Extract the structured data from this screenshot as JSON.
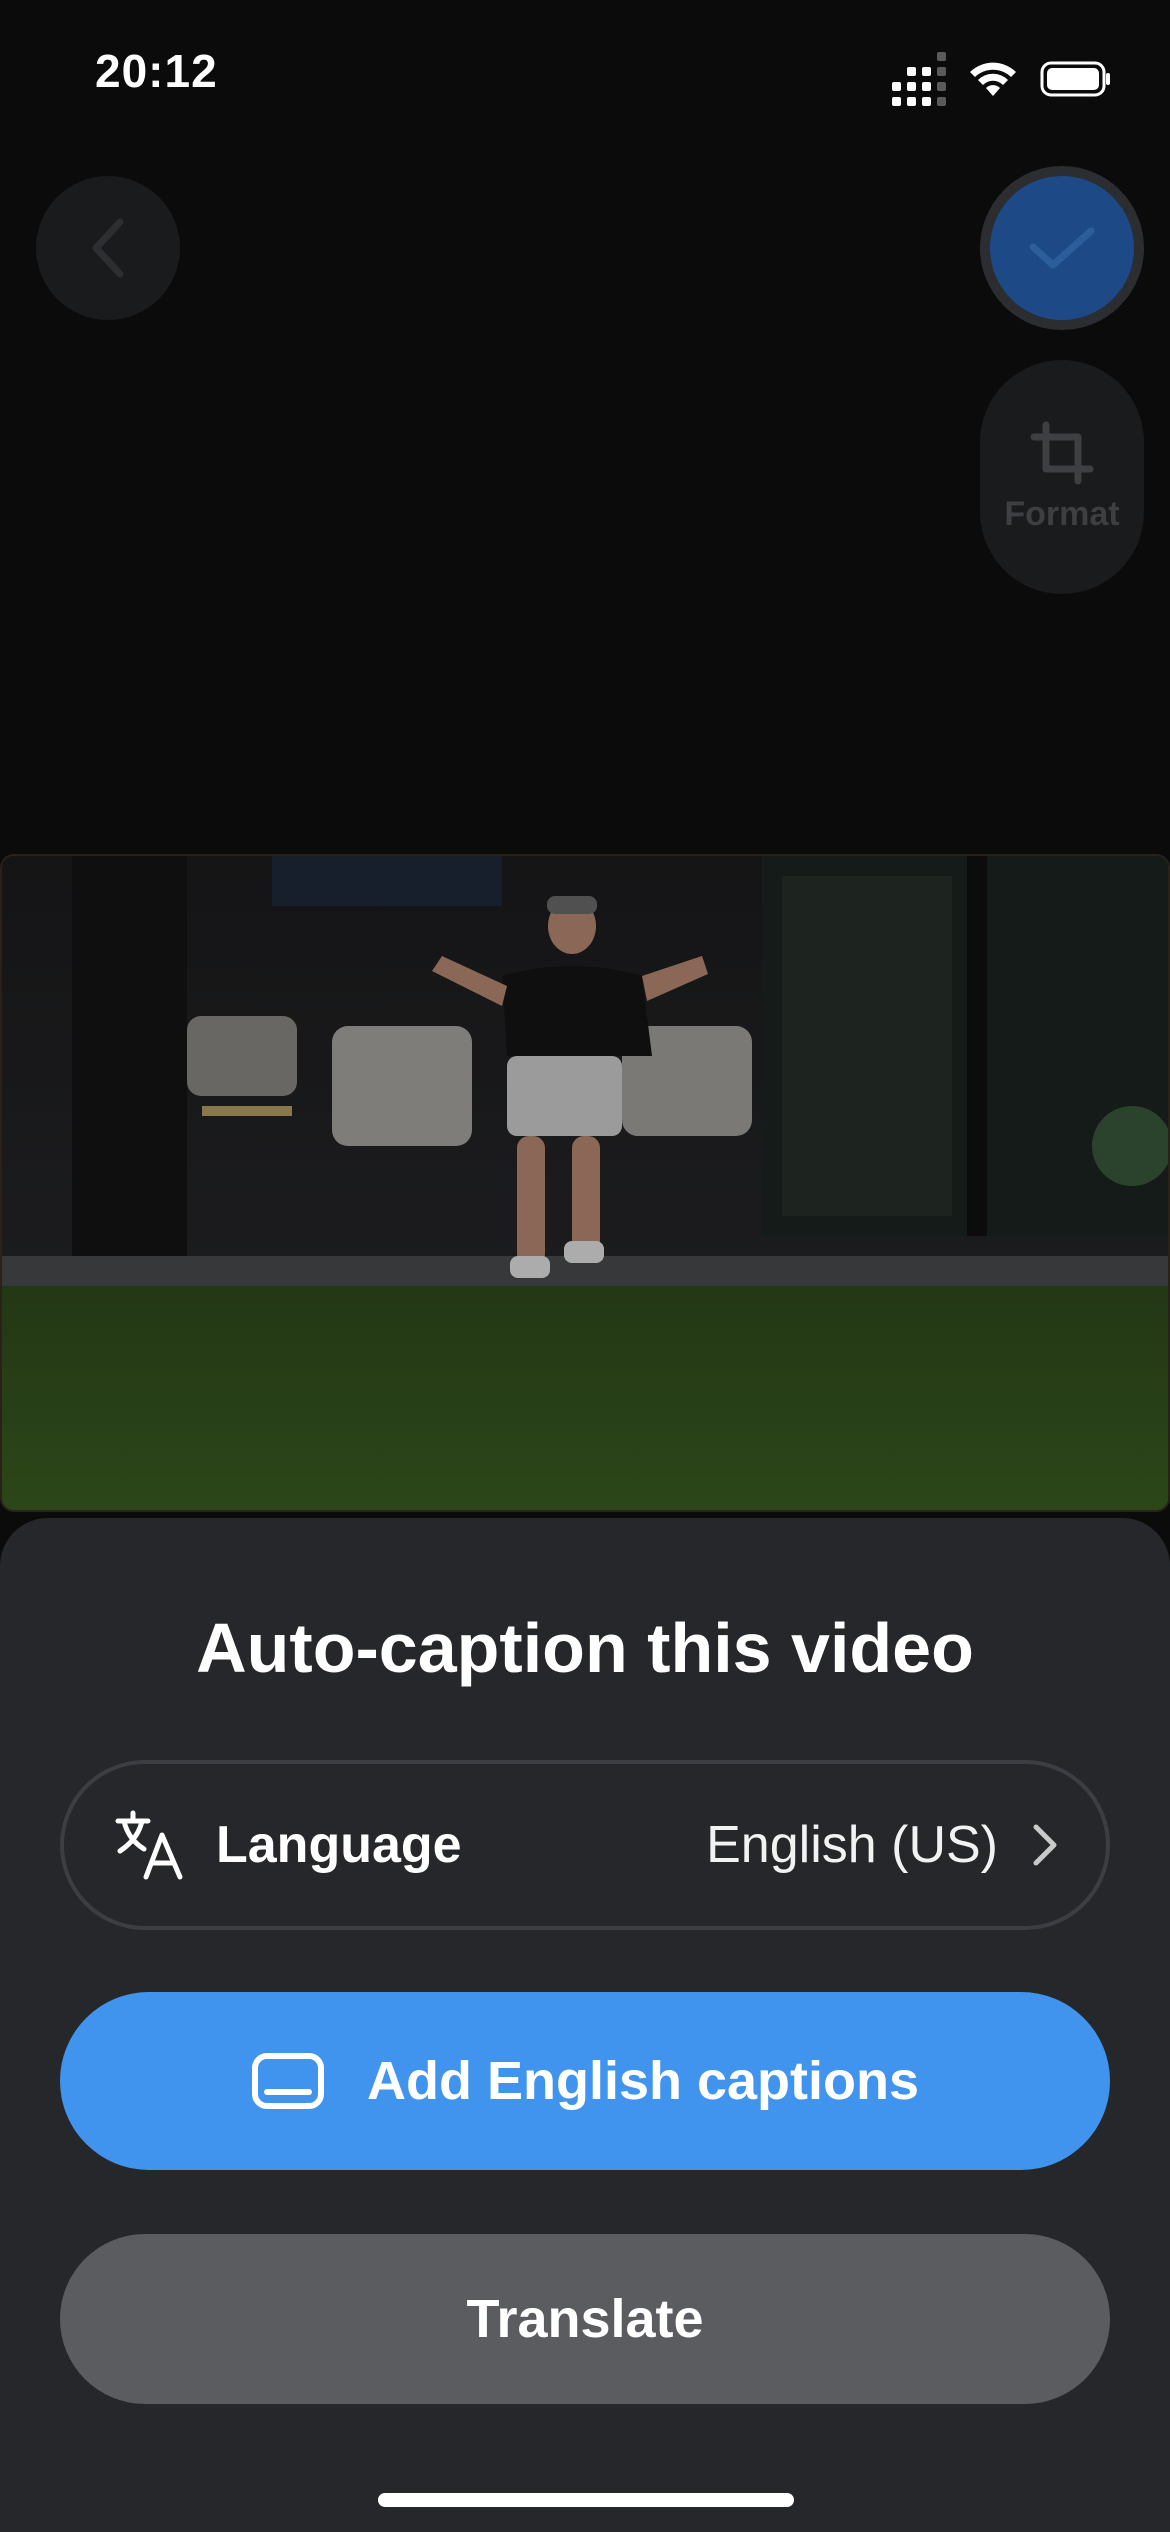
{
  "status_bar": {
    "time": "20:12"
  },
  "toolbar": {
    "format_label": "Format"
  },
  "sheet": {
    "title": "Auto-caption this video",
    "language_label": "Language",
    "language_value": "English (US)",
    "add_captions_label": "Add English captions",
    "translate_label": "Translate"
  },
  "colors": {
    "accent": "#4194ee",
    "sheet_bg": "#26272b",
    "secondary_button": "#5b5c60"
  },
  "icons": [
    "back-chevron-icon",
    "checkmark-icon",
    "crop-icon",
    "translate-icon",
    "chevron-right-icon",
    "captions-icon"
  ]
}
